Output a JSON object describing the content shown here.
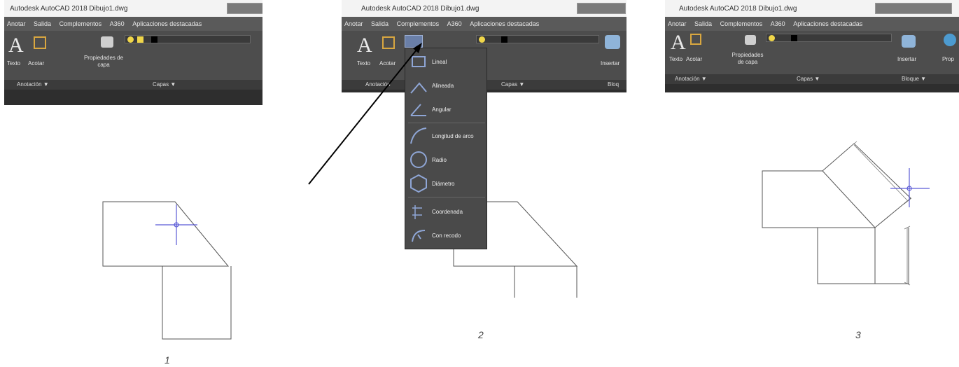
{
  "captions": [
    "1",
    "2",
    "3"
  ],
  "screens": [
    {
      "title": "Autodesk AutoCAD 2018   Dibujo1.dwg",
      "tabs": [
        "Anotar",
        "Salida",
        "Complementos",
        "A360",
        "Aplicaciones destacadas"
      ],
      "tools": {
        "text": "Texto",
        "dim": "Acotar",
        "layer_props": "Propiedades de capa"
      },
      "panels": {
        "annotation": "Anotación ▼",
        "layers": "Capas ▼"
      }
    },
    {
      "title": "Autodesk AutoCAD 2018   Dibujo1.dwg",
      "tabs": [
        "Anotar",
        "Salida",
        "Complementos",
        "A360",
        "Aplicaciones destacadas"
      ],
      "tools": {
        "text": "Texto",
        "dim": "Acotar",
        "insert": "Insertar"
      },
      "panels": {
        "annotation": "Anotación",
        "layers": "Capas ▼",
        "block": "Bloq"
      },
      "dropdown": [
        "Lineal",
        "Alineada",
        "Angular",
        "Longitud de arco",
        "Radio",
        "Diámetro",
        "Coordenada",
        "Con recodo"
      ]
    },
    {
      "title": "Autodesk AutoCAD 2018   Dibujo1.dwg",
      "tabs": [
        "Anotar",
        "Salida",
        "Complementos",
        "A360",
        "Aplicaciones destacadas"
      ],
      "tools": {
        "text": "Texto",
        "dim": "Acotar",
        "layer_props": "Propiedades de capa",
        "insert": "Insertar",
        "props": "Prop"
      },
      "panels": {
        "annotation": "Anotación ▼",
        "layers": "Capas ▼",
        "block": "Bloque ▼"
      }
    }
  ],
  "colors": {
    "ribbon": "#4d4d4d",
    "crosshair": "#5a5ad6",
    "line": "#555555"
  }
}
